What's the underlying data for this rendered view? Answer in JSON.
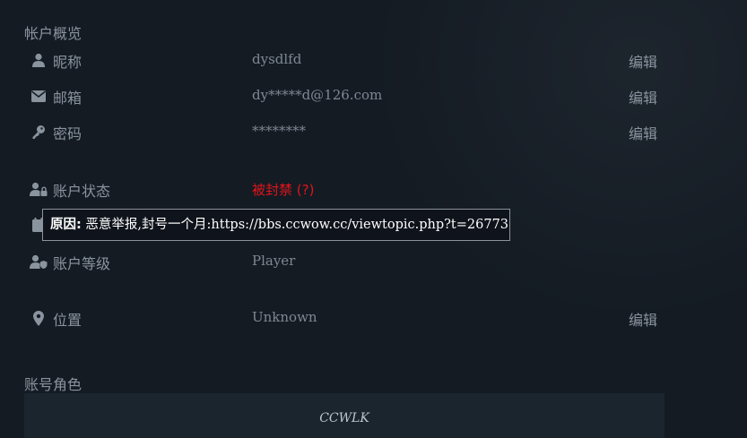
{
  "account_overview": {
    "title": "帐户概览",
    "rows": [
      {
        "icon": "user-icon",
        "label": "昵称",
        "value": "dysdlfd",
        "edit": "编辑"
      },
      {
        "icon": "envelope-icon",
        "label": "邮箱",
        "value": "dy*****d@126.com",
        "edit": "编辑"
      },
      {
        "icon": "key-icon",
        "label": "密码",
        "value": "********",
        "edit": "编辑"
      },
      {
        "icon": "user-lock-icon",
        "label": "账户状态",
        "value": "被封禁 (?)",
        "value_color": "#e2141b"
      },
      {
        "icon": "calendar-icon"
      },
      {
        "icon": "user-shield-icon",
        "label": "账户等级",
        "value": "Player"
      },
      {
        "icon": "map-marker-icon",
        "label": "位置",
        "value": "Unknown",
        "edit": "编辑"
      }
    ]
  },
  "tooltip": {
    "label": "原因:",
    "text": " 恶意举报,封号一个月:https://bbs.ccwow.cc/viewtopic.php?t=26773"
  },
  "account_roles": {
    "title": "账号角色",
    "roles": [
      "CCWLK"
    ]
  }
}
